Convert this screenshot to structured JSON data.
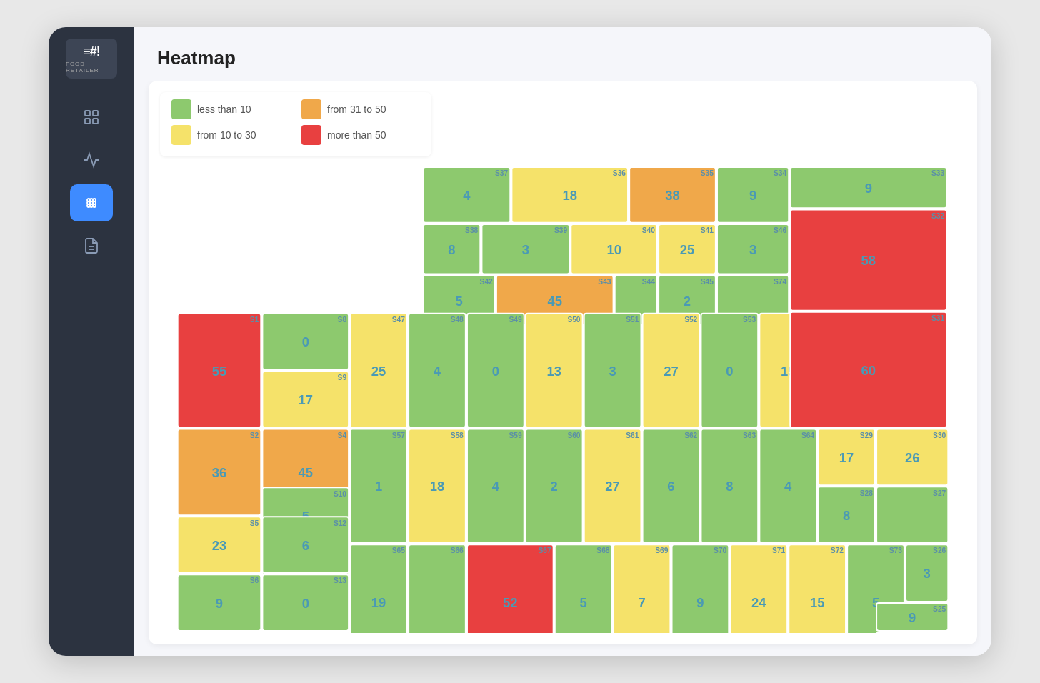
{
  "app": {
    "title": "Heatmap",
    "logo_text": "FOOD RETAILER",
    "logo_icon": "≡#!"
  },
  "sidebar": {
    "nav_items": [
      {
        "label": "dashboard",
        "icon": "⊟",
        "active": false
      },
      {
        "label": "analytics",
        "icon": "📊",
        "active": false
      },
      {
        "label": "heatmap",
        "icon": "⠿",
        "active": true
      },
      {
        "label": "documents",
        "icon": "📄",
        "active": false
      }
    ]
  },
  "legend": {
    "items": [
      {
        "label": "less than 10",
        "color": "#8dc96e"
      },
      {
        "label": "from 31 to 50",
        "color": "#f0a84a"
      },
      {
        "label": "from 10 to 30",
        "color": "#f5e26a"
      },
      {
        "label": "more than 50",
        "color": "#e84040"
      }
    ]
  },
  "colors": {
    "green": "#8dc96e",
    "yellow": "#f5e26a",
    "orange": "#f0a84a",
    "red": "#e84040"
  }
}
